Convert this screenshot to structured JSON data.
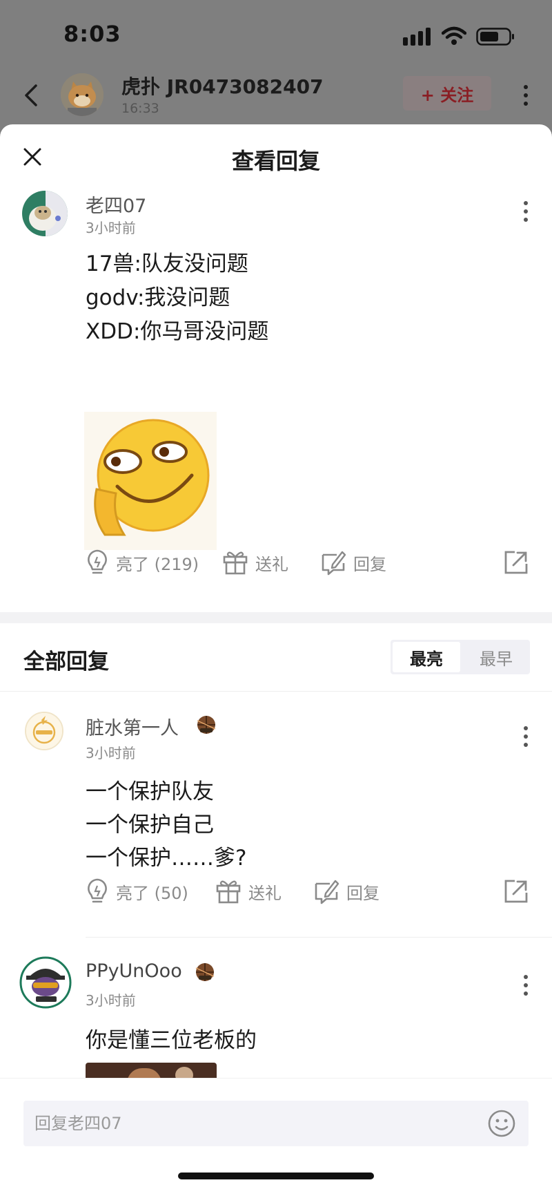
{
  "status_bar": {
    "time": "8:03"
  },
  "background_nav": {
    "title": "虎扑 JR0473082407",
    "time": "16:33",
    "follow_label": "+ 关注"
  },
  "sheet": {
    "title": "查看回复",
    "main_reply": {
      "user": "老四07",
      "time": "3小时前",
      "lines": [
        "17兽:队友没问题",
        "godv:我没问题",
        "XDD:你马哥没问题"
      ],
      "like_label": "亮了 (219)",
      "gift_label": "送礼",
      "reply_label": "回复"
    },
    "section_title": "全部回复",
    "sort": {
      "active": "最亮",
      "inactive": "最早"
    },
    "replies": [
      {
        "user": "脏水第一人",
        "time": "3小时前",
        "lines": [
          "一个保护队友",
          "一个保护自己",
          "一个保护……爹?"
        ],
        "like_label": "亮了 (50)",
        "gift_label": "送礼",
        "reply_label": "回复"
      },
      {
        "user": "PPyUnOoo",
        "time": "3小时前",
        "lines": [
          "你是懂三位老板的"
        ]
      }
    ],
    "input_placeholder": "回复老四07"
  },
  "colors": {
    "dim_overlay": "#7f7f7f",
    "follow_text": "#8a1e24",
    "muted_text": "#8a8a8a",
    "emoji_yellow": "#f7c936"
  }
}
